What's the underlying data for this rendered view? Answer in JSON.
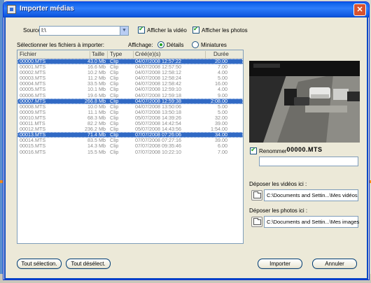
{
  "window": {
    "title": "Importer médias",
    "close_glyph": "✕"
  },
  "source": {
    "label": "Source:",
    "value": "I:\\",
    "arrow": "▼"
  },
  "options": {
    "show_video": {
      "label": "Afficher la vidéo",
      "checked": true
    },
    "show_photos": {
      "label": "Afficher les photos",
      "checked": true
    }
  },
  "file_select_label": "Sélectionner les fichiers à importer:",
  "display": {
    "label": "Affichage:",
    "details": "Détails",
    "thumbnails": "Miniatures",
    "selected": "details"
  },
  "columns": {
    "name": "Fichier",
    "size": "Taille",
    "type": "Type",
    "created": "Créé(e)(s)",
    "duration": "Durée"
  },
  "files": [
    {
      "name": "00000.MTS",
      "size": "43.0 Mb",
      "type": "Clip",
      "created": "04/07/2008 12:57:22",
      "duration": "20.00",
      "selected": true
    },
    {
      "name": "00001.MTS",
      "size": "16.6 Mb",
      "type": "Clip",
      "created": "04/07/2008 12:57:50",
      "duration": "7.00",
      "selected": false
    },
    {
      "name": "00002.MTS",
      "size": "10.2 Mb",
      "type": "Clip",
      "created": "04/07/2008 12:58:12",
      "duration": "4.00",
      "selected": false
    },
    {
      "name": "00003.MTS",
      "size": "11.2 Mb",
      "type": "Clip",
      "created": "04/07/2008 12:58:24",
      "duration": "5.00",
      "selected": false
    },
    {
      "name": "00004.MTS",
      "size": "33.5 Mb",
      "type": "Clip",
      "created": "04/07/2008 12:58:42",
      "duration": "16.00",
      "selected": false
    },
    {
      "name": "00005.MTS",
      "size": "10.1 Mb",
      "type": "Clip",
      "created": "04/07/2008 12:59:10",
      "duration": "4.00",
      "selected": false
    },
    {
      "name": "00006.MTS",
      "size": "19.6 Mb",
      "type": "Clip",
      "created": "04/07/2008 12:59:18",
      "duration": "9.00",
      "selected": false
    },
    {
      "name": "00007.MTS",
      "size": "266.8 Mb",
      "type": "Clip",
      "created": "04/07/2008 12:59:38",
      "duration": "2:08.00",
      "selected": true
    },
    {
      "name": "00008.MTS",
      "size": "10.0 Mb",
      "type": "Clip",
      "created": "04/07/2008 13:50:06",
      "duration": "5.00",
      "selected": false
    },
    {
      "name": "00009.MTS",
      "size": "11.1 Mb",
      "type": "Clip",
      "created": "04/07/2008 13:50:18",
      "duration": "5.00",
      "selected": false
    },
    {
      "name": "00010.MTS",
      "size": "68.3 Mb",
      "type": "Clip",
      "created": "05/07/2008 14:39:26",
      "duration": "32.00",
      "selected": false
    },
    {
      "name": "00011.MTS",
      "size": "82.2 Mb",
      "type": "Clip",
      "created": "05/07/2008 14:42:54",
      "duration": "39.00",
      "selected": false
    },
    {
      "name": "00012.MTS",
      "size": "236.2 Mb",
      "type": "Clip",
      "created": "05/07/2008 14:43:56",
      "duration": "1:54.00",
      "selected": false
    },
    {
      "name": "00013.MTS",
      "size": "71.4 Mb",
      "type": "Clip",
      "created": "07/07/2008 07:26:06",
      "duration": "34.00",
      "selected": true
    },
    {
      "name": "00014.MTS",
      "size": "83.5 Mb",
      "type": "Clip",
      "created": "07/07/2008 07:27:16",
      "duration": "39.00",
      "selected": false
    },
    {
      "name": "00015.MTS",
      "size": "14.3 Mb",
      "type": "Clip",
      "created": "07/07/2008 09:35:46",
      "duration": "6.00",
      "selected": false
    },
    {
      "name": "00016.MTS",
      "size": "15.5 Mb",
      "type": "Clip",
      "created": "07/07/2008 10:22:10",
      "duration": "7.00",
      "selected": false
    }
  ],
  "preview": {
    "filename": "00000.MTS"
  },
  "rename": {
    "label": "Renommer",
    "checked": true,
    "value": ""
  },
  "videos_dest": {
    "label": "Déposer les vidéos ici :",
    "path": "C:\\Documents and Settin...\\Mes vidéos"
  },
  "photos_dest": {
    "label": "Déposer les photos ici :",
    "path": "C:\\Documents and Settin...\\Mes images"
  },
  "buttons": {
    "select_all": "Tout sélection.",
    "deselect_all": "Tout désélect.",
    "import": "Importer",
    "cancel": "Annuler"
  },
  "colors": {
    "selection": "#316ac5",
    "title_bar": "#0a5ee8",
    "window_bg": "#ece9d8"
  }
}
